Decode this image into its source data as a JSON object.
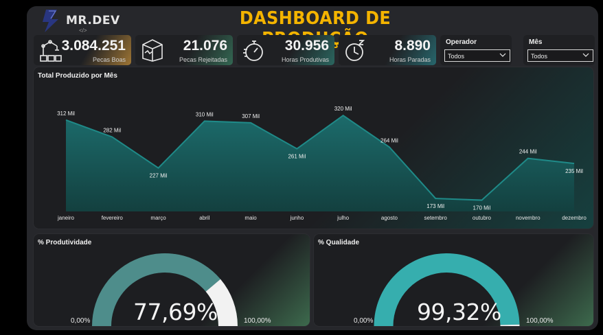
{
  "logo": {
    "text": "MR.DEV",
    "sub": "</>"
  },
  "title": "DASHBOARD DE PRODUÇÃO",
  "kpis": [
    {
      "value": "3.084.251",
      "label": "Pecas Boas",
      "icon": "robot-arm-icon",
      "accent": "#c8913a"
    },
    {
      "value": "21.076",
      "label": "Pecas Rejeitadas",
      "icon": "damaged-box-icon",
      "accent": "#3a7f62"
    },
    {
      "value": "30.956",
      "label": "Horas Produtivas",
      "icon": "stopwatch-icon",
      "accent": "#2f7e74"
    },
    {
      "value": "8.890",
      "label": "Horas Paradas",
      "icon": "clock-sleep-icon",
      "accent": "#2a7f86"
    }
  ],
  "filters": [
    {
      "label": "Operador",
      "value": "Todos"
    },
    {
      "label": "Mês",
      "value": "Todos"
    }
  ],
  "chart_data": {
    "type": "area",
    "title": "Total Produzido por Mês",
    "categories": [
      "janeiro",
      "fevereiro",
      "março",
      "abril",
      "maio",
      "junho",
      "julho",
      "agosto",
      "setembro",
      "outubro",
      "novembro",
      "dezembro"
    ],
    "values": [
      312,
      282,
      227,
      310,
      307,
      261,
      320,
      264,
      173,
      170,
      244,
      235
    ],
    "data_labels": [
      "312 Mil",
      "282 Mil",
      "227 Mil",
      "310 Mil",
      "307 Mil",
      "261 Mil",
      "320 Mil",
      "264 Mil",
      "173 Mil",
      "170 Mil",
      "244 Mil",
      "235 Mil"
    ],
    "ylim": [
      150,
      330
    ],
    "color": "#1c6b6b",
    "line_color": "#1f8a88"
  },
  "gauges": [
    {
      "title": "% Produtividade",
      "value_text": "77,69%",
      "value": 0.7769,
      "min": "0,00%",
      "max": "100,00%",
      "fill": "#4e8d8b",
      "rest": "#f2f2f2"
    },
    {
      "title": "% Qualidade",
      "value_text": "99,32%",
      "value": 0.9932,
      "min": "0,00%",
      "max": "100,00%",
      "fill": "#36aeae",
      "rest": "#f2f2f2"
    }
  ]
}
